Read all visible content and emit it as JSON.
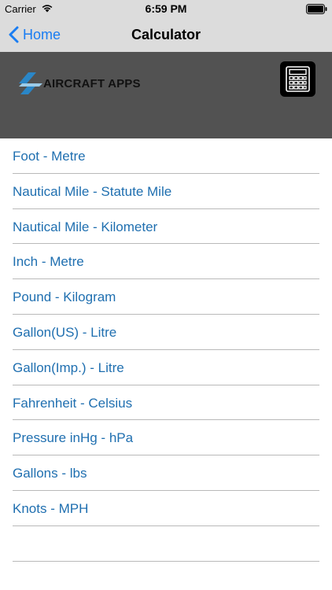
{
  "status_bar": {
    "carrier": "Carrier",
    "time": "6:59 PM"
  },
  "nav": {
    "back_label": "Home",
    "title": "Calculator",
    "tint_color": "#1a7df2"
  },
  "banner": {
    "logo_text": "AIRCRAFT APPS",
    "background_color": "#525252",
    "calculator_icon": "calculator-icon"
  },
  "list": {
    "text_color": "#1f6fb0",
    "items": [
      {
        "label": "Foot - Metre"
      },
      {
        "label": "Nautical Mile - Statute Mile"
      },
      {
        "label": "Nautical Mile - Kilometer"
      },
      {
        "label": "Inch - Metre"
      },
      {
        "label": "Pound - Kilogram"
      },
      {
        "label": "Gallon(US) - Litre"
      },
      {
        "label": "Gallon(Imp.) - Litre"
      },
      {
        "label": "Fahrenheit - Celsius"
      },
      {
        "label": "Pressure inHg - hPa"
      },
      {
        "label": "Gallons - lbs"
      },
      {
        "label": "Knots - MPH"
      },
      {
        "label": ""
      }
    ]
  }
}
